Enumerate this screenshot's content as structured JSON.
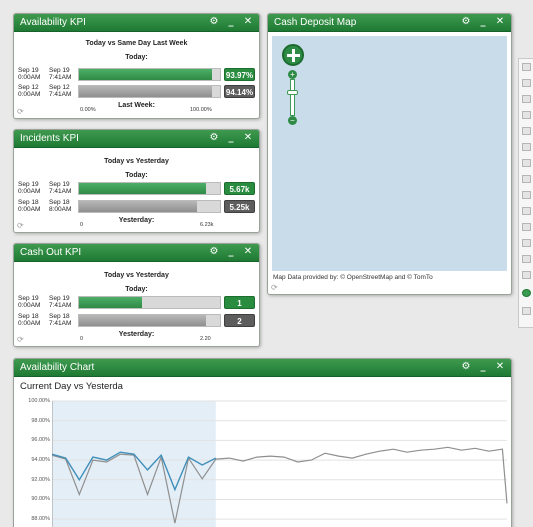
{
  "colors": {
    "header_green": "#2a8c3f",
    "fill_green": "#3c9e55",
    "fill_gray": "#a3a3a3",
    "map_water": "#c8dcea",
    "chart_today_line": "#3f8fba",
    "chart_yesterday_line": "#8f8f8f",
    "chart_highlight": "#e4eef7"
  },
  "window_controls": {
    "settings": "⚙",
    "minimize": "_",
    "close": "✕"
  },
  "availability_kpi": {
    "title": "Availability KPI",
    "comparison": "Today vs Same Day Last Week",
    "today_label": "Today:",
    "rows": [
      {
        "from": "Sep 19 0:00AM",
        "to": "Sep 19 7:41AM",
        "value": "93.97%",
        "fill": 0.94,
        "style": "green"
      },
      {
        "from": "Sep 12 0:00AM",
        "to": "Sep 12 7:41AM",
        "value": "94.14%",
        "fill": 0.94,
        "style": "gray"
      }
    ],
    "axis_min": "0.00%",
    "axis_max": "100.00%",
    "last_label": "Last Week:"
  },
  "incidents_kpi": {
    "title": "Incidents KPI",
    "comparison": "Today vs Yesterday",
    "today_label": "Today:",
    "rows": [
      {
        "from": "Sep 19 0:00AM",
        "to": "Sep 19 7:41AM",
        "value": "5.67k",
        "fill": 0.9,
        "style": "green"
      },
      {
        "from": "Sep 18 0:00AM",
        "to": "Sep 18 8:00AM",
        "value": "5.25k",
        "fill": 0.84,
        "style": "gray"
      }
    ],
    "axis_min": "0",
    "axis_max": "6.23k",
    "last_label": "Yesterday:"
  },
  "cash_out_kpi": {
    "title": "Cash Out KPI",
    "comparison": "Today vs Yesterday",
    "today_label": "Today:",
    "rows": [
      {
        "from": "Sep 19 0:00AM",
        "to": "Sep 19 7:41AM",
        "value": "1",
        "fill": 0.45,
        "style": "green"
      },
      {
        "from": "Sep 18 0:00AM",
        "to": "Sep 18 7:41AM",
        "value": "2",
        "fill": 0.9,
        "style": "gray"
      }
    ],
    "axis_min": "0",
    "axis_max": "2.20",
    "last_label": "Yesterday:"
  },
  "cash_deposit_map": {
    "title": "Cash Deposit Map",
    "credit": "Map Data provided by: © OpenStreetMap and © TomTo"
  },
  "availability_chart": {
    "title": "Availability Chart",
    "subtitle": "Current Day vs Yesterda"
  },
  "chart_data": {
    "type": "line",
    "title": "Current Day vs Yesterda",
    "ylim": [
      87.0,
      100.0
    ],
    "y_ticks": [
      "100.00%",
      "98.00%",
      "96.00%",
      "94.00%",
      "92.00%",
      "90.00%",
      "88.00%"
    ],
    "y_tick_values": [
      100,
      98,
      96,
      94,
      92,
      90,
      88
    ],
    "x": [
      0,
      3,
      6,
      9,
      12,
      15,
      18,
      21,
      24,
      27,
      30,
      33,
      36,
      39,
      42,
      45,
      48,
      51,
      54,
      57,
      60,
      63,
      66,
      69,
      72,
      75,
      78,
      81,
      84,
      87,
      90,
      93,
      96,
      99,
      100
    ],
    "series": [
      {
        "values": [
          94.5,
          94.1,
          90.5,
          94.0,
          93.8,
          94.6,
          94.5,
          90.5,
          94.3,
          87.6,
          94.2,
          92.1,
          94.1,
          94.2,
          93.9,
          94.3,
          94.4,
          94.3,
          93.8,
          94.0,
          94.7,
          94.4,
          94.2,
          94.6,
          94.9,
          95.1,
          94.8,
          95.0,
          95.1,
          95.3,
          95.0,
          95.2,
          94.9,
          95.1,
          89.6
        ],
        "color": "#8f8f8f"
      },
      {
        "values": [
          94.6,
          94.2,
          92.0,
          94.3,
          94.0,
          94.8,
          94.6,
          93.0,
          94.5,
          91.0,
          94.3,
          93.5,
          94.2
        ],
        "color": "#3f8fba"
      }
    ]
  }
}
